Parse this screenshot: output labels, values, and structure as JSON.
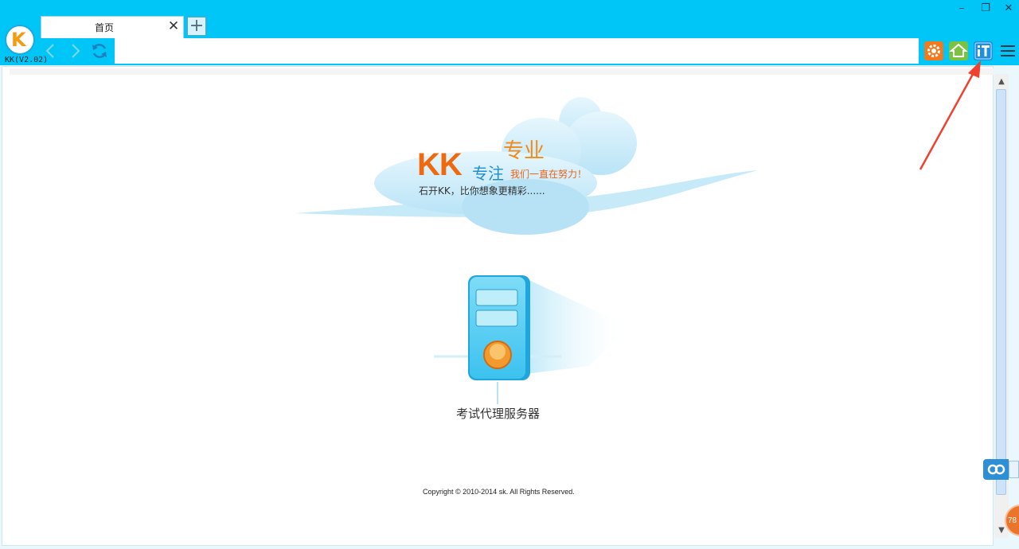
{
  "app": {
    "version_label": "KK(V2.02)",
    "logo_text": "K"
  },
  "tabs": [
    {
      "label": "首页",
      "close_glyph": "✕"
    }
  ],
  "new_tab_glyph": "+",
  "window_controls": {
    "minimize": "–",
    "restore": "❐",
    "close": "✕"
  },
  "toolbar": {
    "address_value": "",
    "buttons": [
      "settings-icon",
      "home-icon",
      "it-icon",
      "menu-icon"
    ],
    "it_label": "iT"
  },
  "page": {
    "brand": "KK",
    "tagline_top": "专业",
    "tagline_main": "专注",
    "slogan": "我们一直在努力！",
    "subtitle": "石开KK，比你想象更精彩......",
    "server_label": "考试代理服务器",
    "copyright": "Copyright © 2010-2014 sk. All Rights Reserved."
  },
  "floating": {
    "badge_text": "78"
  },
  "colors": {
    "chrome": "#00c6f7",
    "brand_orange": "#ef6a0e",
    "brand_blue": "#1f8fd1",
    "settings_btn": "#f07a1d",
    "home_btn": "#7cc242",
    "it_btn": "#1f8fe0",
    "annotation_arrow": "#f0412f"
  }
}
